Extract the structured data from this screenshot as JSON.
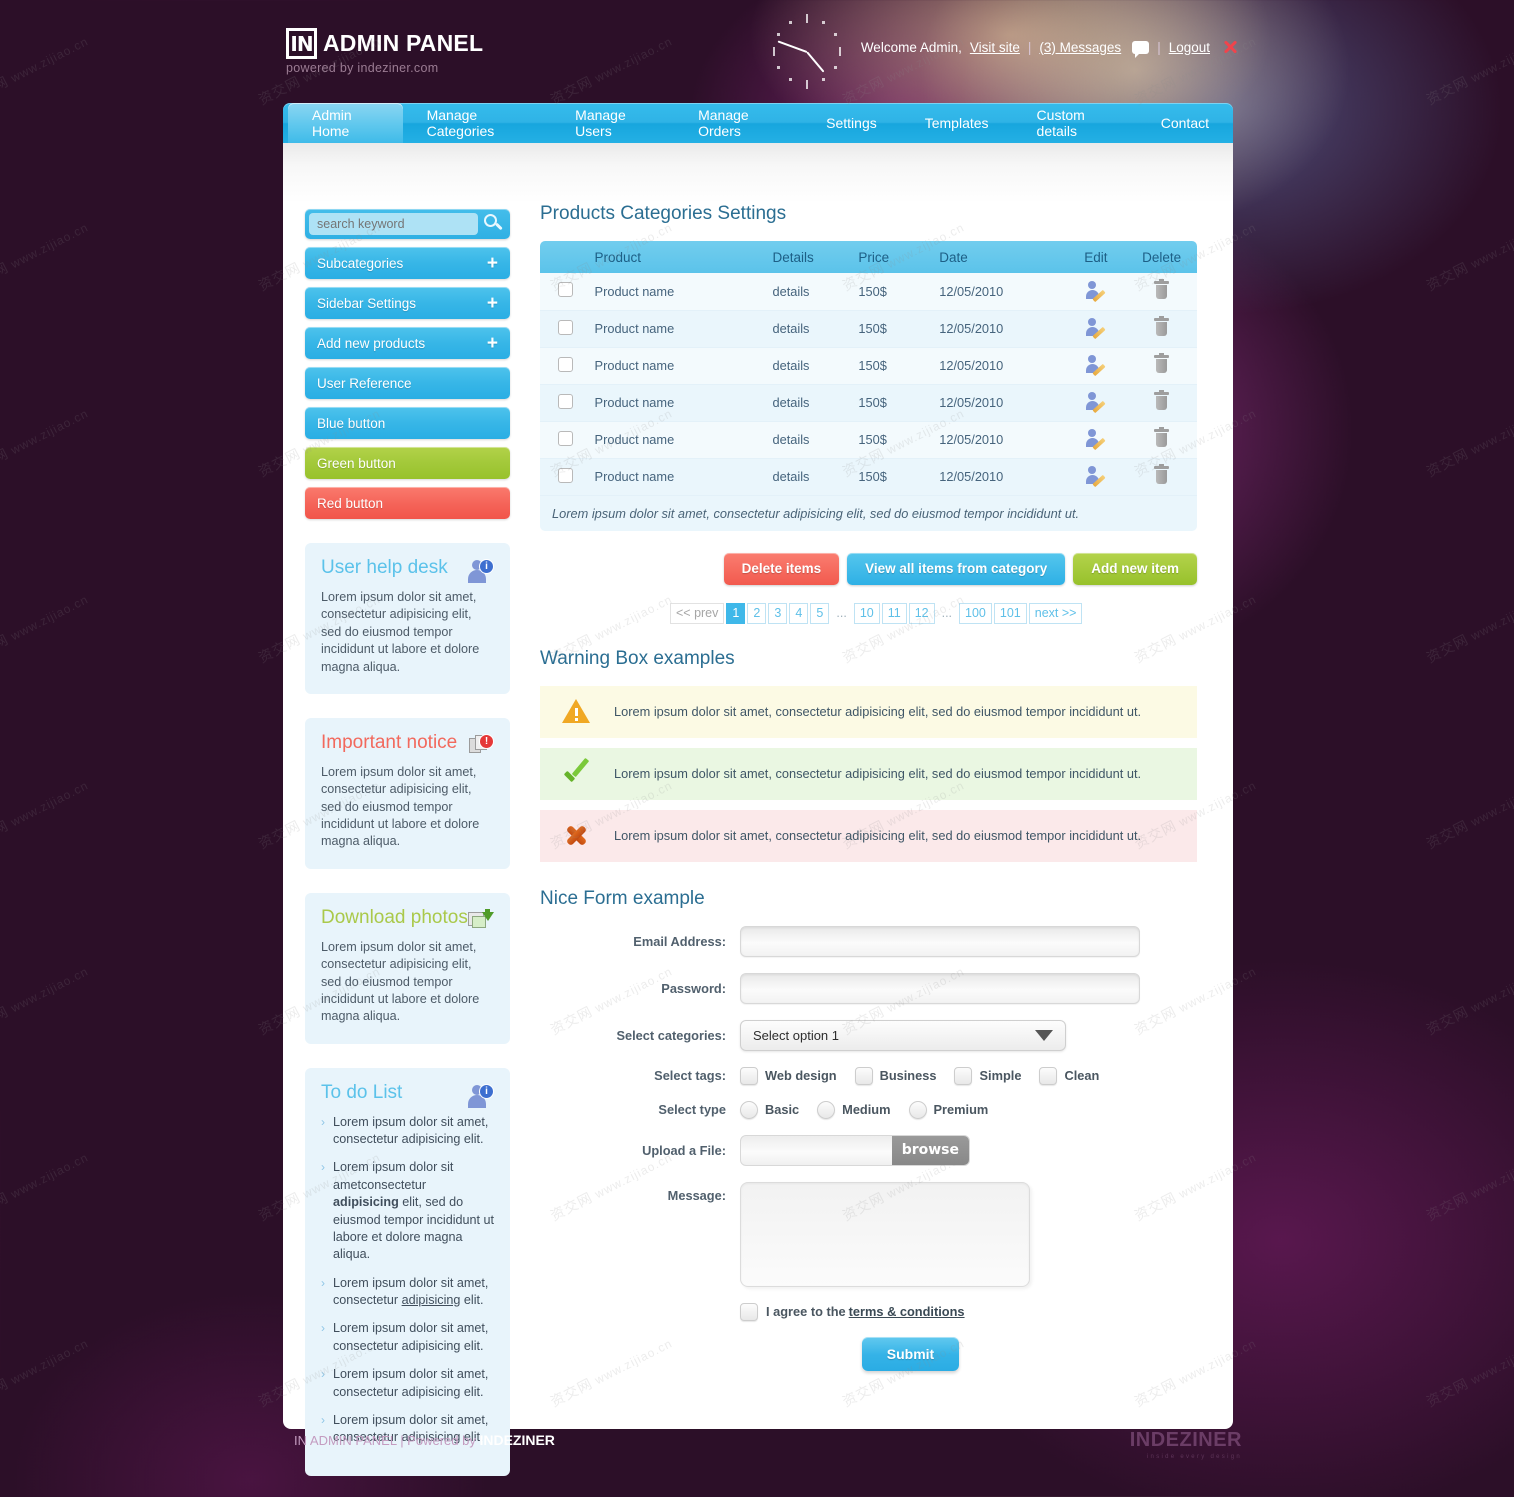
{
  "header": {
    "logo_mark": "IN",
    "logo_title": "ADMIN PANEL",
    "logo_sub": "powered by indeziner.com",
    "welcome": "Welcome Admin,",
    "visit_site": "Visit site",
    "sep1": "|",
    "messages": "(3) Messages",
    "sep2": "|",
    "logout": "Logout"
  },
  "nav": {
    "items": [
      {
        "label": "Admin Home",
        "active": true
      },
      {
        "label": "Manage Categories",
        "active": false
      },
      {
        "label": "Manage Users",
        "active": false
      },
      {
        "label": "Manage Orders",
        "active": false
      },
      {
        "label": "Settings",
        "active": false
      },
      {
        "label": "Templates",
        "active": false
      },
      {
        "label": "Custom details",
        "active": false
      },
      {
        "label": "Contact",
        "active": false
      }
    ]
  },
  "sidebar": {
    "search_placeholder": "search keyword",
    "search_value": "",
    "buttons": [
      {
        "label": "Subcategories",
        "color": "blue",
        "plus": "+"
      },
      {
        "label": "Sidebar Settings",
        "color": "blue",
        "plus": "+"
      },
      {
        "label": "Add new products",
        "color": "blue",
        "plus": "+"
      },
      {
        "label": "User Reference",
        "color": "blue",
        "plus": ""
      },
      {
        "label": "Blue button",
        "color": "blue",
        "plus": ""
      },
      {
        "label": "Green button",
        "color": "green",
        "plus": ""
      },
      {
        "label": "Red button",
        "color": "red",
        "plus": ""
      }
    ],
    "cards": [
      {
        "title": "User help desk",
        "title_color": "blue",
        "icon": "user-info-icon",
        "badge": "i",
        "body": "Lorem ipsum dolor sit amet, consectetur adipisicing elit, sed do eiusmod tempor incididunt ut labore et dolore magna aliqua."
      },
      {
        "title": "Important notice",
        "title_color": "red",
        "icon": "document-alert-icon",
        "badge": "!",
        "body": "Lorem ipsum dolor sit amet, consectetur adipisicing elit, sed do eiusmod tempor incididunt ut labore et dolore magna aliqua."
      },
      {
        "title": "Download photos",
        "title_color": "green",
        "icon": "photo-download-icon",
        "badge": "",
        "body": "Lorem ipsum dolor sit amet, consectetur adipisicing elit, sed do eiusmod tempor incididunt ut labore et dolore magna aliqua."
      }
    ],
    "todo": {
      "title": "To do List",
      "icon": "user-info-icon",
      "badge": "i",
      "items": [
        {
          "text": "Lorem ipsum dolor sit amet, consectetur adipisicing elit.",
          "style": "plain"
        },
        {
          "text": "Lorem ipsum dolor sit ametconsectetur adipisicing elit, sed do eiusmod tempor incididunt ut labore et dolore magna aliqua.",
          "style": "bold-word"
        },
        {
          "text": "Lorem ipsum dolor sit amet, consectetur adipisicing elit.",
          "style": "underline-word"
        },
        {
          "text": "Lorem ipsum dolor sit amet, consectetur adipisicing elit.",
          "style": "plain"
        },
        {
          "text": "Lorem ipsum dolor sit amet, consectetur adipisicing elit.",
          "style": "plain"
        },
        {
          "text": "Lorem ipsum dolor sit amet, consectetur adipisicing elit.",
          "style": "plain"
        }
      ]
    }
  },
  "main": {
    "page_title": "Products Categories Settings",
    "table": {
      "columns": [
        "",
        "Product",
        "Details",
        "Price",
        "Date",
        "Edit",
        "Delete"
      ],
      "rows": [
        {
          "product": "Product name",
          "details": "details",
          "price": "150$",
          "date": "12/05/2010"
        },
        {
          "product": "Product name",
          "details": "details",
          "price": "150$",
          "date": "12/05/2010"
        },
        {
          "product": "Product name",
          "details": "details",
          "price": "150$",
          "date": "12/05/2010"
        },
        {
          "product": "Product name",
          "details": "details",
          "price": "150$",
          "date": "12/05/2010"
        },
        {
          "product": "Product name",
          "details": "details",
          "price": "150$",
          "date": "12/05/2010"
        },
        {
          "product": "Product name",
          "details": "details",
          "price": "150$",
          "date": "12/05/2010"
        }
      ],
      "note": "Lorem ipsum dolor sit amet, consectetur adipisicing elit, sed do eiusmod tempor incididunt ut."
    },
    "actions": {
      "delete": "Delete items",
      "view_all": "View all items from category",
      "add_new": "Add new item"
    },
    "pagination": {
      "prev": "<< prev",
      "pages": [
        "1",
        "2",
        "3",
        "4",
        "5",
        "...",
        "10",
        "11",
        "12",
        "...",
        "100",
        "101"
      ],
      "current": "1",
      "next": "next >>"
    },
    "warning_section_title": "Warning Box examples",
    "alerts": [
      {
        "type": "warn",
        "icon": "warning-triangle-icon",
        "text": "Lorem ipsum dolor sit amet, consectetur adipisicing elit, sed do eiusmod tempor incididunt ut."
      },
      {
        "type": "ok",
        "icon": "check-mark-icon",
        "text": "Lorem ipsum dolor sit amet, consectetur adipisicing elit, sed do eiusmod tempor incididunt ut."
      },
      {
        "type": "err",
        "icon": "error-cross-icon",
        "text": "Lorem ipsum dolor sit amet, consectetur adipisicing elit, sed do eiusmod tempor incididunt ut."
      }
    ],
    "form": {
      "title": "Nice Form example",
      "email_label": "Email Address:",
      "email_value": "",
      "password_label": "Password:",
      "password_value": "",
      "categories_label": "Select categories:",
      "categories_selected": "Select option 1",
      "tags_label": "Select tags:",
      "tags": [
        "Web design",
        "Business",
        "Simple",
        "Clean"
      ],
      "type_label": "Select type",
      "types": [
        "Basic",
        "Medium",
        "Premium"
      ],
      "upload_label": "Upload a File:",
      "upload_value": "",
      "browse_label": "browse",
      "message_label": "Message:",
      "message_value": "",
      "agree_prefix": "I agree to the ",
      "agree_link": "terms & conditions",
      "submit_label": "Submit"
    }
  },
  "footer": {
    "text_plain": "IN ADMIN PANEL | Powered by ",
    "text_bold": "INDEZINER",
    "logo": "INDEZINER",
    "logo_sub": "inside every design"
  },
  "colors": {
    "background": "#2c0f28",
    "accent_blue": "#35b3e7",
    "accent_green": "#a3c93a",
    "accent_red": "#f2695d",
    "heading": "#2b6e92"
  }
}
